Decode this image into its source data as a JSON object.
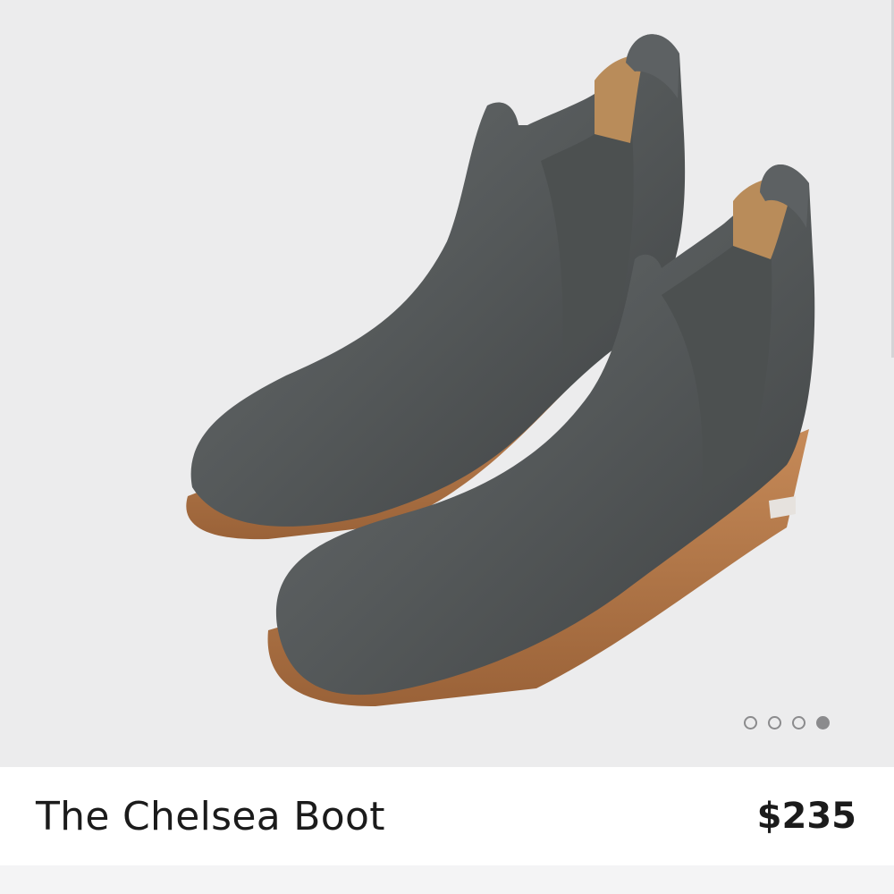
{
  "product": {
    "title": "The Chelsea Boot",
    "price": "$235"
  },
  "image": {
    "subject": "boot-pair-icon",
    "colors": {
      "background": "#ececed",
      "leather": "#55595a",
      "elastic": "#4c5050",
      "lining": "#b98c5a",
      "sole": "#b77a4a"
    }
  },
  "carousel": {
    "total": 4,
    "active_index": 3
  }
}
